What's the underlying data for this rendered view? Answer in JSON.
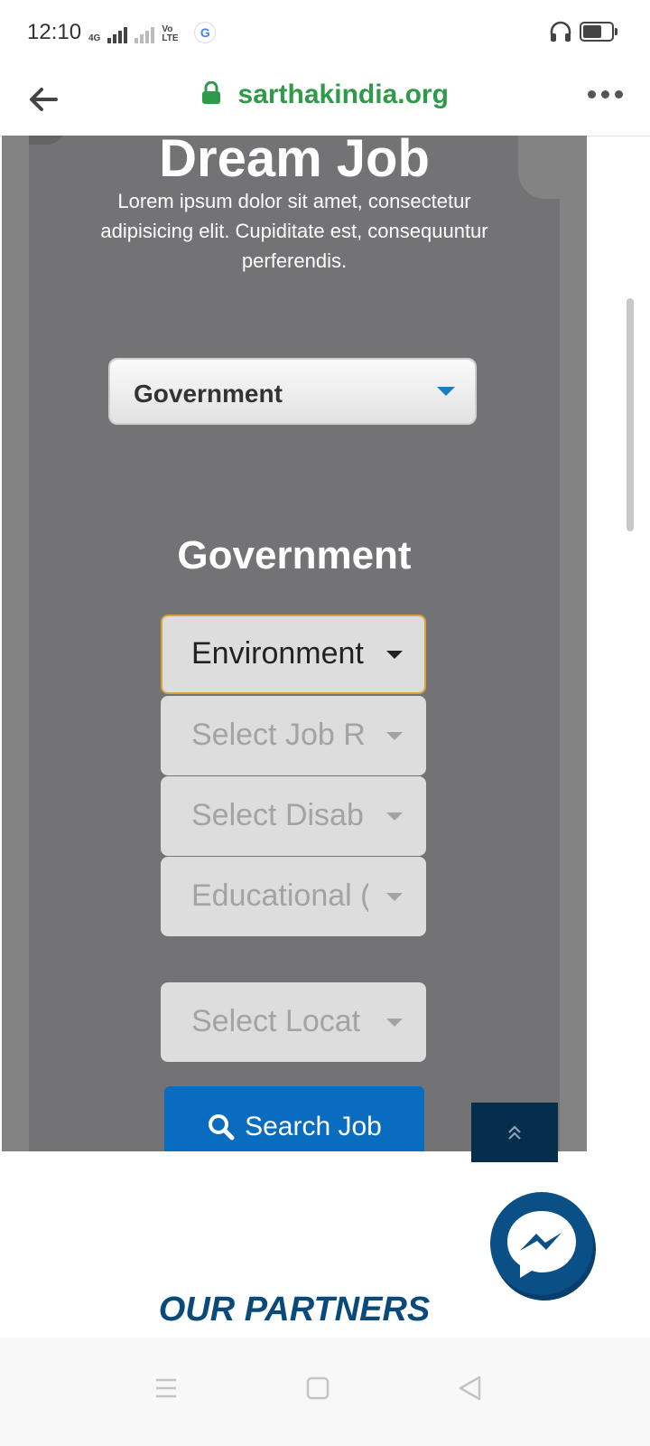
{
  "status_bar": {
    "time": "12:10",
    "network_label": "4G",
    "volte_label": "Vo LTE",
    "google_badge": "G",
    "icons": [
      "signal-icon",
      "signal-icon",
      "google-icon",
      "headphones-icon",
      "battery-icon"
    ]
  },
  "browser": {
    "url": "sarthakindia.org",
    "icons": [
      "back-arrow-icon",
      "lock-icon",
      "more-dots-icon"
    ]
  },
  "hero": {
    "title": "Dream Job",
    "description": "Lorem ipsum dolor sit amet, consectetur adipisicing elit. Cupiditate est, consequuntur perferendis."
  },
  "category_select": {
    "value": "Government"
  },
  "section_title": "Government",
  "filters": [
    {
      "name": "sector-dropdown",
      "value": "Environment",
      "active": true
    },
    {
      "name": "job-role-dropdown",
      "value": "Select Job R",
      "active": false
    },
    {
      "name": "disability-dropdown",
      "value": "Select Disab",
      "active": false
    },
    {
      "name": "education-dropdown",
      "value": "Educational (",
      "active": false
    },
    {
      "name": "location-dropdown",
      "value": "Select Locat",
      "active": false
    }
  ],
  "search_button": {
    "label": "Search Job",
    "icon": "search-icon",
    "color": "#0a6cbf"
  },
  "back_to_top": {
    "icon": "double-chevron-up-icon"
  },
  "messenger": {
    "icon": "messenger-icon",
    "color": "#0a4f86"
  },
  "partners_title": "OUR PARTNERS",
  "nav_bar": {
    "icons": [
      "menu-icon",
      "home-square-icon",
      "back-triangle-icon"
    ]
  },
  "colors": {
    "url_green": "#2e9a4a",
    "accent_blue": "#1a7fbf",
    "focus_border": "#d9a23a",
    "partners_blue": "#0a4a7a"
  }
}
